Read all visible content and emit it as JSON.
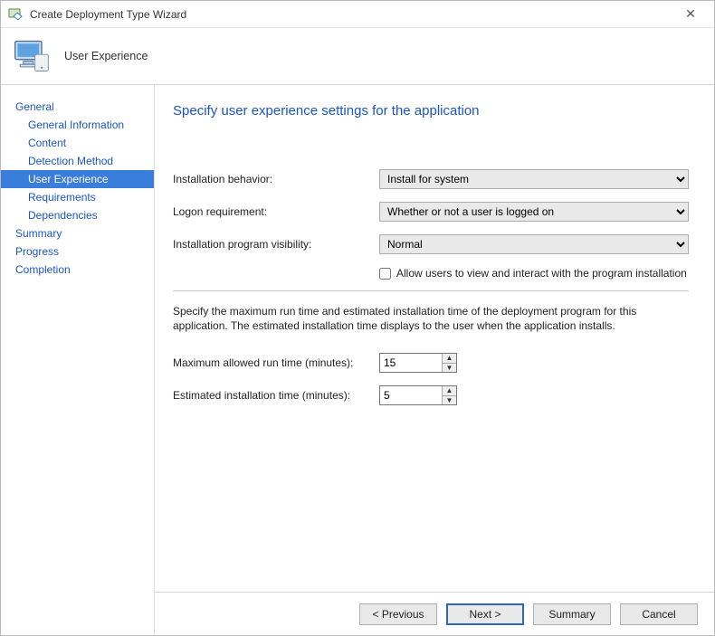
{
  "window": {
    "title": "Create Deployment Type Wizard"
  },
  "header": {
    "page_title": "User Experience"
  },
  "sidebar": {
    "items": [
      {
        "label": "General",
        "sub": false,
        "selected": false
      },
      {
        "label": "General Information",
        "sub": true,
        "selected": false
      },
      {
        "label": "Content",
        "sub": true,
        "selected": false
      },
      {
        "label": "Detection Method",
        "sub": true,
        "selected": false
      },
      {
        "label": "User Experience",
        "sub": true,
        "selected": true
      },
      {
        "label": "Requirements",
        "sub": true,
        "selected": false
      },
      {
        "label": "Dependencies",
        "sub": true,
        "selected": false
      },
      {
        "label": "Summary",
        "sub": false,
        "selected": false
      },
      {
        "label": "Progress",
        "sub": false,
        "selected": false
      },
      {
        "label": "Completion",
        "sub": false,
        "selected": false
      }
    ]
  },
  "content": {
    "heading": "Specify user experience settings for the application",
    "labels": {
      "install_behavior": "Installation behavior:",
      "logon_requirement": "Logon requirement:",
      "install_visibility": "Installation program visibility:",
      "allow_interact": "Allow users to view and interact with the program installation",
      "description": "Specify the maximum run time and estimated installation time of the deployment program for this application. The estimated installation time displays to the user when the application installs.",
      "max_runtime": "Maximum allowed run time (minutes):",
      "est_install": "Estimated installation time (minutes):"
    },
    "values": {
      "install_behavior": "Install for system",
      "logon_requirement": "Whether or not a user is logged on",
      "install_visibility": "Normal",
      "allow_interact_checked": false,
      "max_runtime": "15",
      "est_install": "5"
    }
  },
  "footer": {
    "previous": "< Previous",
    "next": "Next >",
    "summary": "Summary",
    "cancel": "Cancel"
  }
}
